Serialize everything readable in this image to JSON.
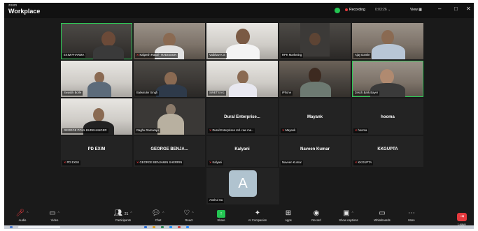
{
  "app": {
    "brand_small": "zoom",
    "brand_large": "Workplace"
  },
  "titlebar": {
    "recording": "Recording",
    "recording_time": "0:03:26",
    "view": "View",
    "minimize_glyph": "–",
    "maximize_glyph": "□",
    "close_glyph": "✕"
  },
  "participants": [
    {
      "name": "EXIM PHARMA"
    },
    {
      "name": "Kalpesh Raval - RADISSON"
    },
    {
      "name": "Vaibhav K.S"
    },
    {
      "name": "RPK Marketing"
    },
    {
      "name": "Ajay Damle"
    },
    {
      "name": "Swastik Borle"
    },
    {
      "name": "Balwinder Singh"
    },
    {
      "name": "SWETS Inc"
    },
    {
      "name": "iPhone"
    },
    {
      "name": "Zesch.Bark.Bayer"
    },
    {
      "name": "GEORGE POUL BURKHANGER"
    },
    {
      "name": "Raghu Ramaraju"
    },
    {
      "title": "Dural Enterprise...",
      "name": "Dural Enterprises Ltd. raw ma..."
    },
    {
      "title": "Mayank",
      "name": "Mayank"
    },
    {
      "title": "hooma",
      "name": "hooma"
    },
    {
      "title": "PD EXIM",
      "name": "PD EXIM"
    },
    {
      "title": "GEORGE BENJA...",
      "name": "GEORGE BENJAMIN SHERRIN"
    },
    {
      "title": "Kalyani",
      "name": "Kalyani"
    },
    {
      "title": "Naveen Kumar",
      "name": "Naveen Kumar"
    },
    {
      "title": "KKGUPTA",
      "name": "KKGUPTA"
    },
    {
      "avatar_letter": "A",
      "name": "Anshul Sa"
    }
  ],
  "toolbar": {
    "audio": "Audio",
    "video": "Video",
    "participants": "Participants",
    "participants_count": "21",
    "chat": "Chat",
    "react": "React",
    "share": "Share",
    "ai_companion": "AI Companion",
    "apps": "Apps",
    "record": "Record",
    "show_captions": "Show captions",
    "whiteboards": "Whiteboards",
    "more": "More",
    "leave": "Leave"
  },
  "colors": {
    "accent_green": "#23c552",
    "recording_red": "#e5393d",
    "avatar_bg": "#b0c3cf"
  }
}
